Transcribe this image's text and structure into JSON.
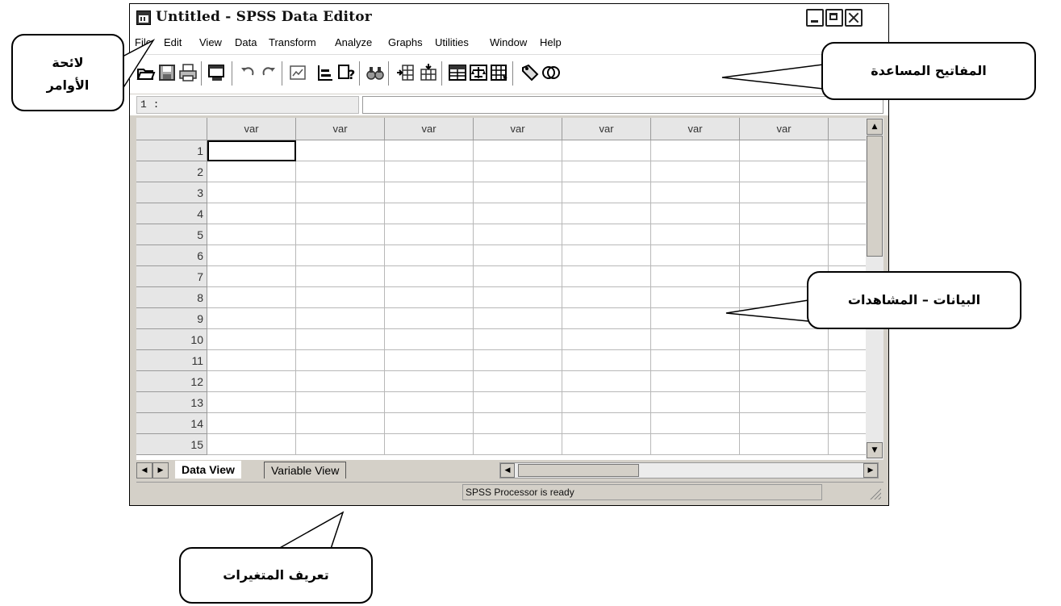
{
  "window": {
    "title": "Untitled - SPSS Data Editor"
  },
  "menubar": [
    "File",
    "Edit",
    "View",
    "Data",
    "Transform",
    "Analyze",
    "Graphs",
    "Utilities",
    "Window",
    "Help"
  ],
  "toolbar": {
    "icons": [
      "open-icon",
      "save-icon",
      "print-icon",
      "dialog-recall-icon",
      "undo-icon",
      "redo-icon",
      "goto-chart-icon",
      "goto-case-icon",
      "variables-icon",
      "find-icon",
      "insert-cases-icon",
      "insert-variable-icon",
      "split-file-icon",
      "weight-cases-icon",
      "select-cases-icon",
      "value-labels-icon",
      "use-sets-icon"
    ]
  },
  "cell_editor": {
    "address": "1 :",
    "value": ""
  },
  "grid": {
    "columns": [
      "var",
      "var",
      "var",
      "var",
      "var",
      "var",
      "var",
      ""
    ],
    "rows": [
      "1",
      "2",
      "3",
      "4",
      "5",
      "6",
      "7",
      "8",
      "9",
      "10",
      "11",
      "12",
      "13",
      "14",
      "15"
    ]
  },
  "tabs": {
    "active": "Data View",
    "other": "Variable View"
  },
  "status": {
    "text": "SPSS Processor  is ready"
  },
  "callouts": {
    "menu_list": [
      "لائحة",
      "الأوامر"
    ],
    "toolbar_keys": "المفاتيح المساعدة",
    "data_cases": "البيانات  –  المشاهدات",
    "variable_definition": "تعريف المتغيرات"
  }
}
